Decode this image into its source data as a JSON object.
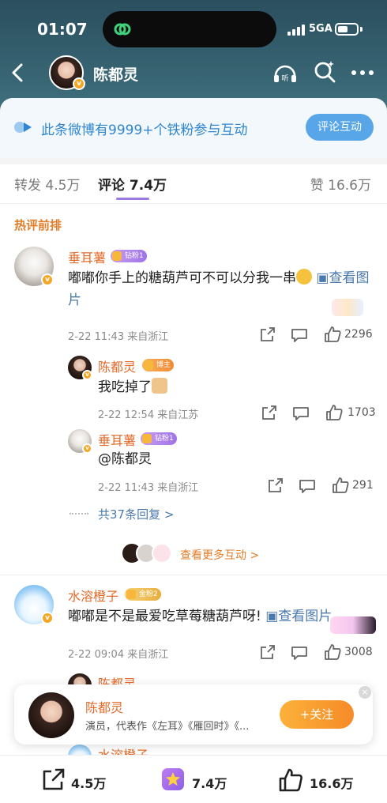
{
  "status_bar": {
    "time": "01:07",
    "network": "5GA"
  },
  "header": {
    "name": "陈都灵"
  },
  "fan_banner": {
    "text": "此条微博有9999+个铁粉参与互动",
    "button": "评论互动"
  },
  "tabs": {
    "repost": "转发 4.5万",
    "comment": "评论 7.4万",
    "like": "赞 16.6万"
  },
  "section_title": "热评前排",
  "comments": {
    "c1": {
      "name": "垂耳薯",
      "tag": "钻粉1",
      "text": "嘟嘟你手上的糖葫芦可不可以分我一串",
      "image_link": "查看图片",
      "meta": "2-22 11:43  来自浙江",
      "likes": "2296"
    },
    "r1": {
      "name": "陈都灵",
      "tag": "博主",
      "text": "我吃掉了",
      "meta": "2-22 12:54  来自江苏",
      "likes": "1703"
    },
    "r2": {
      "name": "垂耳薯",
      "tag": "钻粉1",
      "text": "@陈都灵",
      "meta": "2-22 11:43  来自浙江",
      "likes": "291"
    },
    "more_replies": "共37条回复 >",
    "more_interact": "查看更多互动 >",
    "c2": {
      "name": "水溶橙子",
      "tag": "金粉2",
      "text": "嘟嘟是不是最爱吃草莓糖葫芦呀!",
      "image_link": "查看图片",
      "meta": "2-22 09:04  来自浙江",
      "likes": "3008"
    },
    "partial1": {
      "name": "陈都灵"
    },
    "partial2": {
      "name": "水溶橙子"
    }
  },
  "follow_card": {
    "name": "陈都灵",
    "desc": "演员，代表作《左耳》《雁回时》《...",
    "button": "+关注",
    "close": "×"
  },
  "bottom_bar": {
    "repost": "4.5万",
    "comment": "7.4万",
    "like": "16.6万"
  },
  "colors": {
    "header_bg": "#2b4f5f",
    "accent_orange": "#e36b2b",
    "link_blue": "#4a79ad",
    "tab_underline": "#9b7be3"
  },
  "icons": [
    "back-icon",
    "listen-icon",
    "search-icon",
    "more-icon",
    "share-icon",
    "comment-icon",
    "like-icon",
    "star-icon"
  ]
}
